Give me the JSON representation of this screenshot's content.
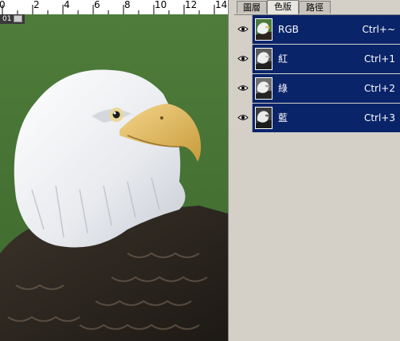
{
  "ruler": {
    "labels": [
      "0",
      "2",
      "4",
      "6",
      "8",
      "10",
      "12",
      "14"
    ]
  },
  "document": {
    "tag": "01"
  },
  "panel": {
    "tabs": [
      {
        "label": "圖層",
        "active": false
      },
      {
        "label": "色版",
        "active": true
      },
      {
        "label": "路徑",
        "active": false
      }
    ],
    "channels": [
      {
        "name": "RGB",
        "shortcut": "Ctrl+~",
        "visible": true,
        "thumb": "color"
      },
      {
        "name": "紅",
        "shortcut": "Ctrl+1",
        "visible": true,
        "thumb": "gray"
      },
      {
        "name": "綠",
        "shortcut": "Ctrl+2",
        "visible": true,
        "thumb": "gray"
      },
      {
        "name": "藍",
        "shortcut": "Ctrl+3",
        "visible": true,
        "thumb": "gray"
      }
    ]
  },
  "colors": {
    "selection": "#0a246a",
    "panel_bg": "#d4d0c8",
    "photo_bg": "#4c7a3a"
  },
  "icons": {
    "visibility": "eye-icon",
    "document": "document-thumbnail-icon"
  }
}
